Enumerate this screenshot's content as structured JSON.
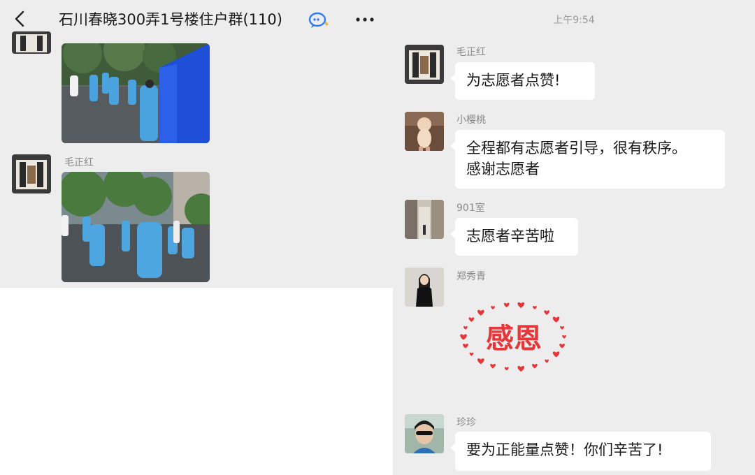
{
  "header": {
    "title": "石川春晓300弄1号楼住户群(110)",
    "back_icon": "chevron-left-icon",
    "group_badge_icon": "chat-bubble-icon",
    "more_icon": "more-dots-icon"
  },
  "left_chat": {
    "messages": [
      {
        "sender": "",
        "type": "image",
        "description_icon": "photo-volunteers-tent"
      },
      {
        "sender": "毛正红",
        "type": "image",
        "description_icon": "photo-volunteers-road"
      }
    ]
  },
  "right_chat": {
    "timestamp": "上午9:54",
    "messages": [
      {
        "sender": "毛正红",
        "type": "text",
        "text": "为志愿者点赞!"
      },
      {
        "sender": "小樱桃",
        "type": "text",
        "text_line1": "全程都有志愿者引导，很有秩序。",
        "text_line2": "感谢志愿者"
      },
      {
        "sender": "901室",
        "type": "text",
        "text": "志愿者辛苦啦"
      },
      {
        "sender": "郑秀青",
        "type": "sticker",
        "sticker_text": "感恩"
      },
      {
        "sender": "珍珍",
        "type": "text",
        "text": "要为正能量点赞！你们辛苦了!"
      }
    ]
  },
  "colors": {
    "background": "#ededed",
    "bubble": "#ffffff",
    "nickname": "#8a8a8a",
    "sticker_red": "#e5373a",
    "badge_blue": "#2f7df6"
  }
}
